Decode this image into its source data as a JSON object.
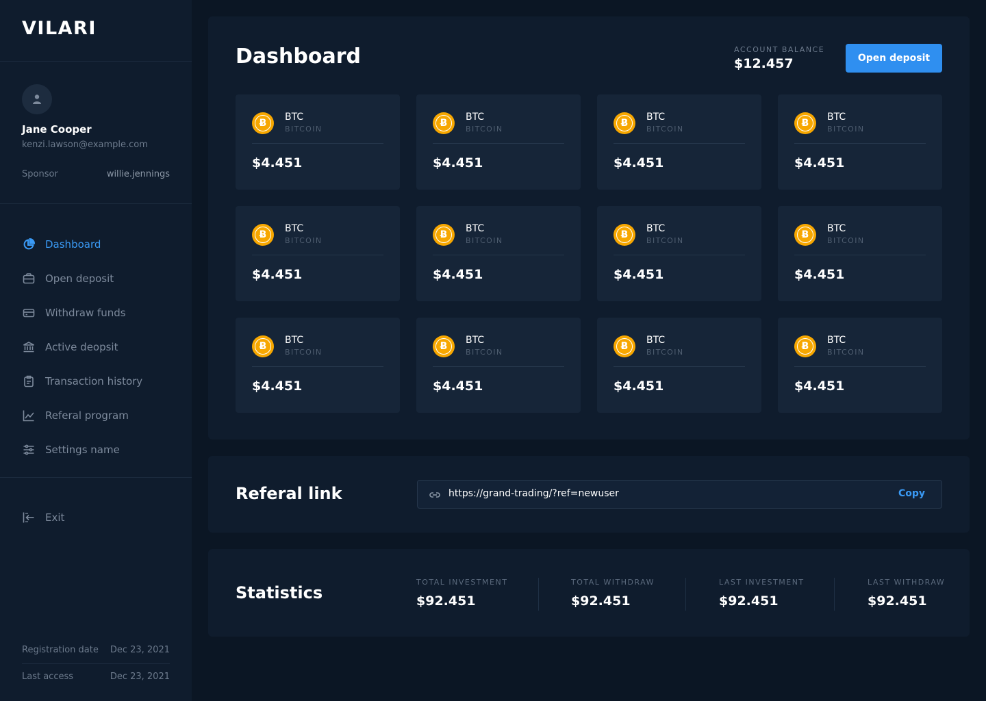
{
  "app": {
    "logo": "VILARI"
  },
  "user": {
    "name": "Jane Cooper",
    "email": "kenzi.lawson@example.com",
    "sponsor_label": "Sponsor",
    "sponsor_value": "willie.jennings"
  },
  "nav": {
    "items": [
      {
        "label": "Dashboard",
        "icon": "pie-chart-icon",
        "active": true
      },
      {
        "label": "Open deposit",
        "icon": "briefcase-icon"
      },
      {
        "label": "Withdraw funds",
        "icon": "credit-card-icon"
      },
      {
        "label": "Active deopsit",
        "icon": "bank-icon"
      },
      {
        "label": "Transaction history",
        "icon": "clipboard-icon"
      },
      {
        "label": "Referal program",
        "icon": "trending-up-icon"
      },
      {
        "label": "Settings name",
        "icon": "sliders-icon"
      }
    ],
    "exit_label": "Exit"
  },
  "footer": {
    "registration_label": "Registration date",
    "registration_value": "Dec 23, 2021",
    "access_label": "Last access",
    "access_value": "Dec 23, 2021"
  },
  "dashboard": {
    "title": "Dashboard",
    "balance_label": "ACCOUNT BALANCE",
    "balance_value": "$12.457",
    "open_deposit_label": "Open deposit",
    "cards": [
      {
        "symbol": "BTC",
        "name": "BITCOIN",
        "value": "$4.451"
      },
      {
        "symbol": "BTC",
        "name": "BITCOIN",
        "value": "$4.451"
      },
      {
        "symbol": "BTC",
        "name": "BITCOIN",
        "value": "$4.451"
      },
      {
        "symbol": "BTC",
        "name": "BITCOIN",
        "value": "$4.451"
      },
      {
        "symbol": "BTC",
        "name": "BITCOIN",
        "value": "$4.451"
      },
      {
        "symbol": "BTC",
        "name": "BITCOIN",
        "value": "$4.451"
      },
      {
        "symbol": "BTC",
        "name": "BITCOIN",
        "value": "$4.451"
      },
      {
        "symbol": "BTC",
        "name": "BITCOIN",
        "value": "$4.451"
      },
      {
        "symbol": "BTC",
        "name": "BITCOIN",
        "value": "$4.451"
      },
      {
        "symbol": "BTC",
        "name": "BITCOIN",
        "value": "$4.451"
      },
      {
        "symbol": "BTC",
        "name": "BITCOIN",
        "value": "$4.451"
      },
      {
        "symbol": "BTC",
        "name": "BITCOIN",
        "value": "$4.451"
      }
    ]
  },
  "referral": {
    "title": "Referal link",
    "url": "https://grand-trading/?ref=newuser",
    "copy_label": "Copy"
  },
  "statistics": {
    "title": "Statistics",
    "items": [
      {
        "label": "TOTAL INVESTMENT",
        "value": "$92.451"
      },
      {
        "label": "TOTAL WITHDRAW",
        "value": "$92.451"
      },
      {
        "label": "LAST INVESTMENT",
        "value": "$92.451"
      },
      {
        "label": "LAST WITHDRAW",
        "value": "$92.451"
      }
    ]
  },
  "colors": {
    "background": "#0b1624",
    "panel": "#0f1c2d",
    "card": "#162538",
    "accent": "#2f8ff0",
    "coin": "#f7a700"
  }
}
